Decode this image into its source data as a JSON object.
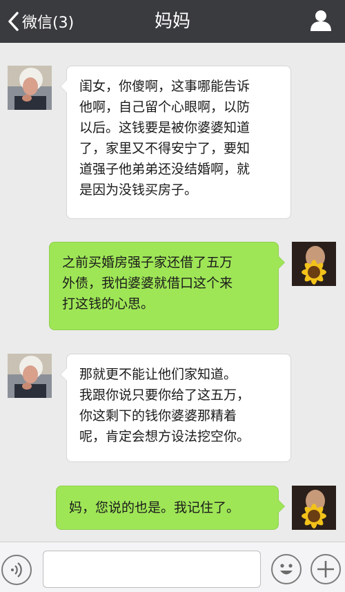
{
  "header": {
    "back_label": "微信(3)",
    "title": "妈妈",
    "back_icon": "chevron-left-icon",
    "profile_icon": "person-icon"
  },
  "messages": [
    {
      "side": "left",
      "sender": "mom",
      "text": "闺女，你傻啊，这事哪能告诉\n他啊，自己留个心眼啊，以防\n以后。这钱要是被你婆婆知道\n了，家里又不得安宁了，要知\n道强子他弟弟还没结婚啊，就\n是因为没钱买房子。"
    },
    {
      "side": "right",
      "sender": "me",
      "text": "之前买婚房强子家还借了五万\n外债，我怕婆婆就借口这个来\n打这钱的心思。"
    },
    {
      "side": "left",
      "sender": "mom",
      "text": "那就更不能让他们家知道。\n我跟你说只要你给了这五万，\n你这剩下的钱你婆婆那精着\n呢，肯定会想方设法挖空你。"
    },
    {
      "side": "right",
      "sender": "me",
      "text": "妈，您说的也是。我记住了。"
    }
  ],
  "colors": {
    "header_bg": "#3a3b3f",
    "chat_bg": "#ebebeb",
    "sent_bubble": "#9fe657",
    "received_bubble": "#ffffff"
  },
  "input_bar": {
    "voice_icon": "voice-icon",
    "emoji_icon": "smiley-icon",
    "plus_icon": "plus-icon",
    "value": ""
  }
}
